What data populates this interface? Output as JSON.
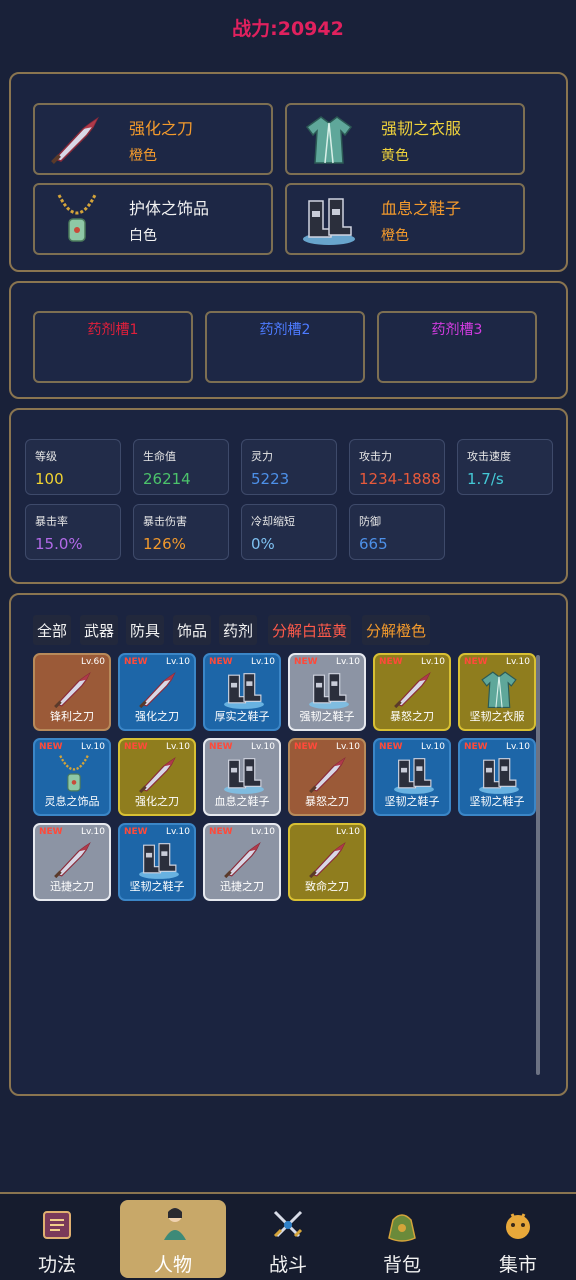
{
  "power": "战力:20942",
  "equipment": [
    {
      "name": "强化之刀",
      "grade": "橙色",
      "icon": "knife-icon"
    },
    {
      "name": "强韧之衣服",
      "grade": "黄色",
      "icon": "robe-icon"
    },
    {
      "name": "护体之饰品",
      "grade": "白色",
      "icon": "necklace-icon"
    },
    {
      "name": "血息之鞋子",
      "grade": "橙色",
      "icon": "boots-icon"
    }
  ],
  "potions": [
    {
      "label": "药剂槽1",
      "color": "#e01f3b"
    },
    {
      "label": "药剂槽2",
      "color": "#4d7bff"
    },
    {
      "label": "药剂槽3",
      "color": "#d23ce0"
    }
  ],
  "stats": [
    {
      "label": "等级",
      "value": "100",
      "color": "#f1d431"
    },
    {
      "label": "生命值",
      "value": "26214",
      "color": "#4cc36b"
    },
    {
      "label": "灵力",
      "value": "5223",
      "color": "#4d90e8"
    },
    {
      "label": "攻击力",
      "value": "1234-1888",
      "color": "#e85a3b"
    },
    {
      "label": "攻击速度",
      "value": "1.7/s",
      "color": "#44c9d6"
    },
    {
      "label": "暴击率",
      "value": "15.0%",
      "color": "#b26ae8"
    },
    {
      "label": "暴击伤害",
      "value": "126%",
      "color": "#f39a2c"
    },
    {
      "label": "冷却缩短",
      "value": "0%",
      "color": "#7ec0f0"
    },
    {
      "label": "防御",
      "value": "665",
      "color": "#4d90e8"
    }
  ],
  "filters": [
    {
      "label": "全部",
      "color": "#f2f2f2"
    },
    {
      "label": "武器",
      "color": "#f2f2f2"
    },
    {
      "label": "防具",
      "color": "#f2f2f2"
    },
    {
      "label": "饰品",
      "color": "#f2f2f2"
    },
    {
      "label": "药剂",
      "color": "#f2f2f2"
    },
    {
      "label": "分解白蓝黄",
      "color": "#ff5a4a"
    },
    {
      "label": "分解橙色",
      "color": "#f39a2c"
    }
  ],
  "items": [
    {
      "name": "锋利之刀",
      "level": "Lv.60",
      "new": "",
      "rarity": "orange",
      "icon": "knife-icon"
    },
    {
      "name": "强化之刀",
      "level": "Lv.10",
      "new": "NEW",
      "rarity": "blue",
      "icon": "knife-icon"
    },
    {
      "name": "厚实之鞋子",
      "level": "Lv.10",
      "new": "NEW",
      "rarity": "blue",
      "icon": "boots-icon"
    },
    {
      "name": "强韧之鞋子",
      "level": "Lv.10",
      "new": "NEW",
      "rarity": "white",
      "icon": "boots-icon"
    },
    {
      "name": "暴怒之刀",
      "level": "Lv.10",
      "new": "NEW",
      "rarity": "yellow",
      "icon": "knife-icon"
    },
    {
      "name": "坚韧之衣服",
      "level": "Lv.10",
      "new": "NEW",
      "rarity": "yellow",
      "icon": "robe-icon"
    },
    {
      "name": "灵息之饰品",
      "level": "Lv.10",
      "new": "NEW",
      "rarity": "blue",
      "icon": "necklace-icon"
    },
    {
      "name": "强化之刀",
      "level": "Lv.10",
      "new": "NEW",
      "rarity": "yellow",
      "icon": "knife-icon"
    },
    {
      "name": "血息之鞋子",
      "level": "Lv.10",
      "new": "NEW",
      "rarity": "white",
      "icon": "boots-icon"
    },
    {
      "name": "暴怒之刀",
      "level": "Lv.10",
      "new": "NEW",
      "rarity": "orange",
      "icon": "knife-icon"
    },
    {
      "name": "坚韧之鞋子",
      "level": "Lv.10",
      "new": "NEW",
      "rarity": "blue",
      "icon": "boots-icon"
    },
    {
      "name": "坚韧之鞋子",
      "level": "Lv.10",
      "new": "NEW",
      "rarity": "blue",
      "icon": "boots-icon"
    },
    {
      "name": "迅捷之刀",
      "level": "Lv.10",
      "new": "NEW",
      "rarity": "white",
      "icon": "knife-icon"
    },
    {
      "name": "坚韧之鞋子",
      "level": "Lv.10",
      "new": "NEW",
      "rarity": "blue",
      "icon": "boots-icon"
    },
    {
      "name": "迅捷之刀",
      "level": "Lv.10",
      "new": "NEW",
      "rarity": "white",
      "icon": "knife-icon"
    },
    {
      "name": "致命之刀",
      "level": "Lv.10",
      "new": "",
      "rarity": "yellow",
      "icon": "knife-icon"
    }
  ],
  "nav": [
    {
      "label": "功法",
      "icon": "scroll-icon",
      "active": false
    },
    {
      "label": "人物",
      "icon": "character-icon",
      "active": true
    },
    {
      "label": "战斗",
      "icon": "crossed-swords-icon",
      "active": false
    },
    {
      "label": "背包",
      "icon": "bag-icon",
      "active": false
    },
    {
      "label": "集市",
      "icon": "market-icon",
      "active": false
    }
  ]
}
